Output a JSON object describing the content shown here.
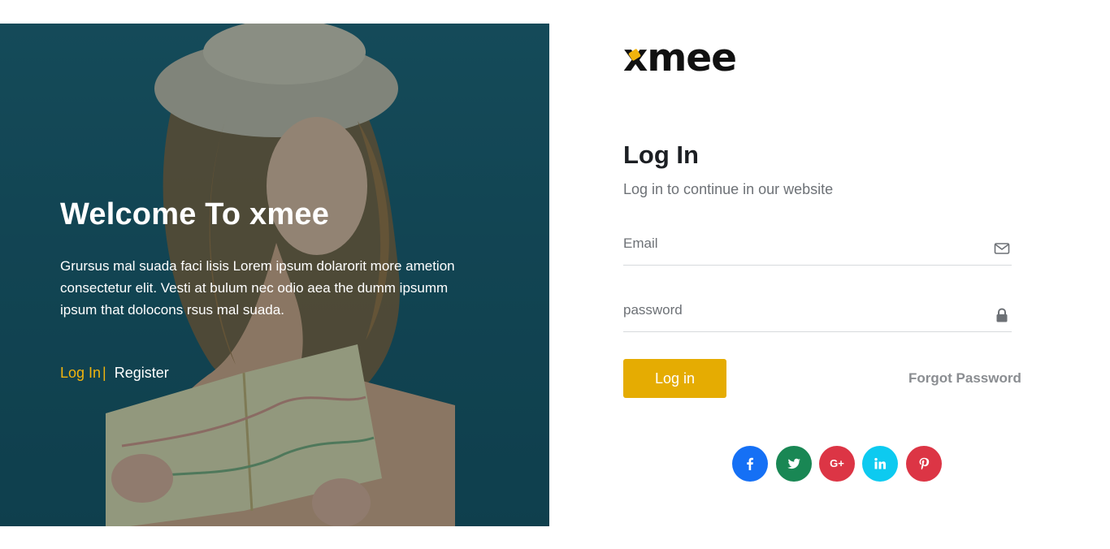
{
  "hero": {
    "title": "Welcome To xmee",
    "description": "Grursus mal suada faci lisis Lorem ipsum dolarorit more ametion consectetur elit. Vesti at bulum nec odio aea the dumm ipsumm ipsum that dolocons rsus mal suada.",
    "login_link": "Log In",
    "separator": "|",
    "register_link": "Register"
  },
  "brand": {
    "logo_text": "mee",
    "logo_initial": "x",
    "accent_color": "#f1b40d"
  },
  "form": {
    "title": "Log In",
    "subtitle": "Log in to continue in our website",
    "email_placeholder": "Email",
    "email_icon": "envelope-icon",
    "password_placeholder": "password",
    "password_icon": "lock-icon",
    "submit_label": "Log in",
    "forgot_label": "Forgot Password",
    "button_color": "#e5ac02"
  },
  "socials": [
    {
      "name": "facebook",
      "icon": "facebook-icon",
      "color": "#1570f5"
    },
    {
      "name": "twitter",
      "icon": "twitter-icon",
      "color": "#198754"
    },
    {
      "name": "google-plus",
      "icon": "google-plus-icon",
      "label": "G+",
      "color": "#dc3545"
    },
    {
      "name": "linkedin",
      "icon": "linkedin-icon",
      "color": "#0dcaf0"
    },
    {
      "name": "pinterest",
      "icon": "pinterest-icon",
      "color": "#dc3545"
    }
  ]
}
